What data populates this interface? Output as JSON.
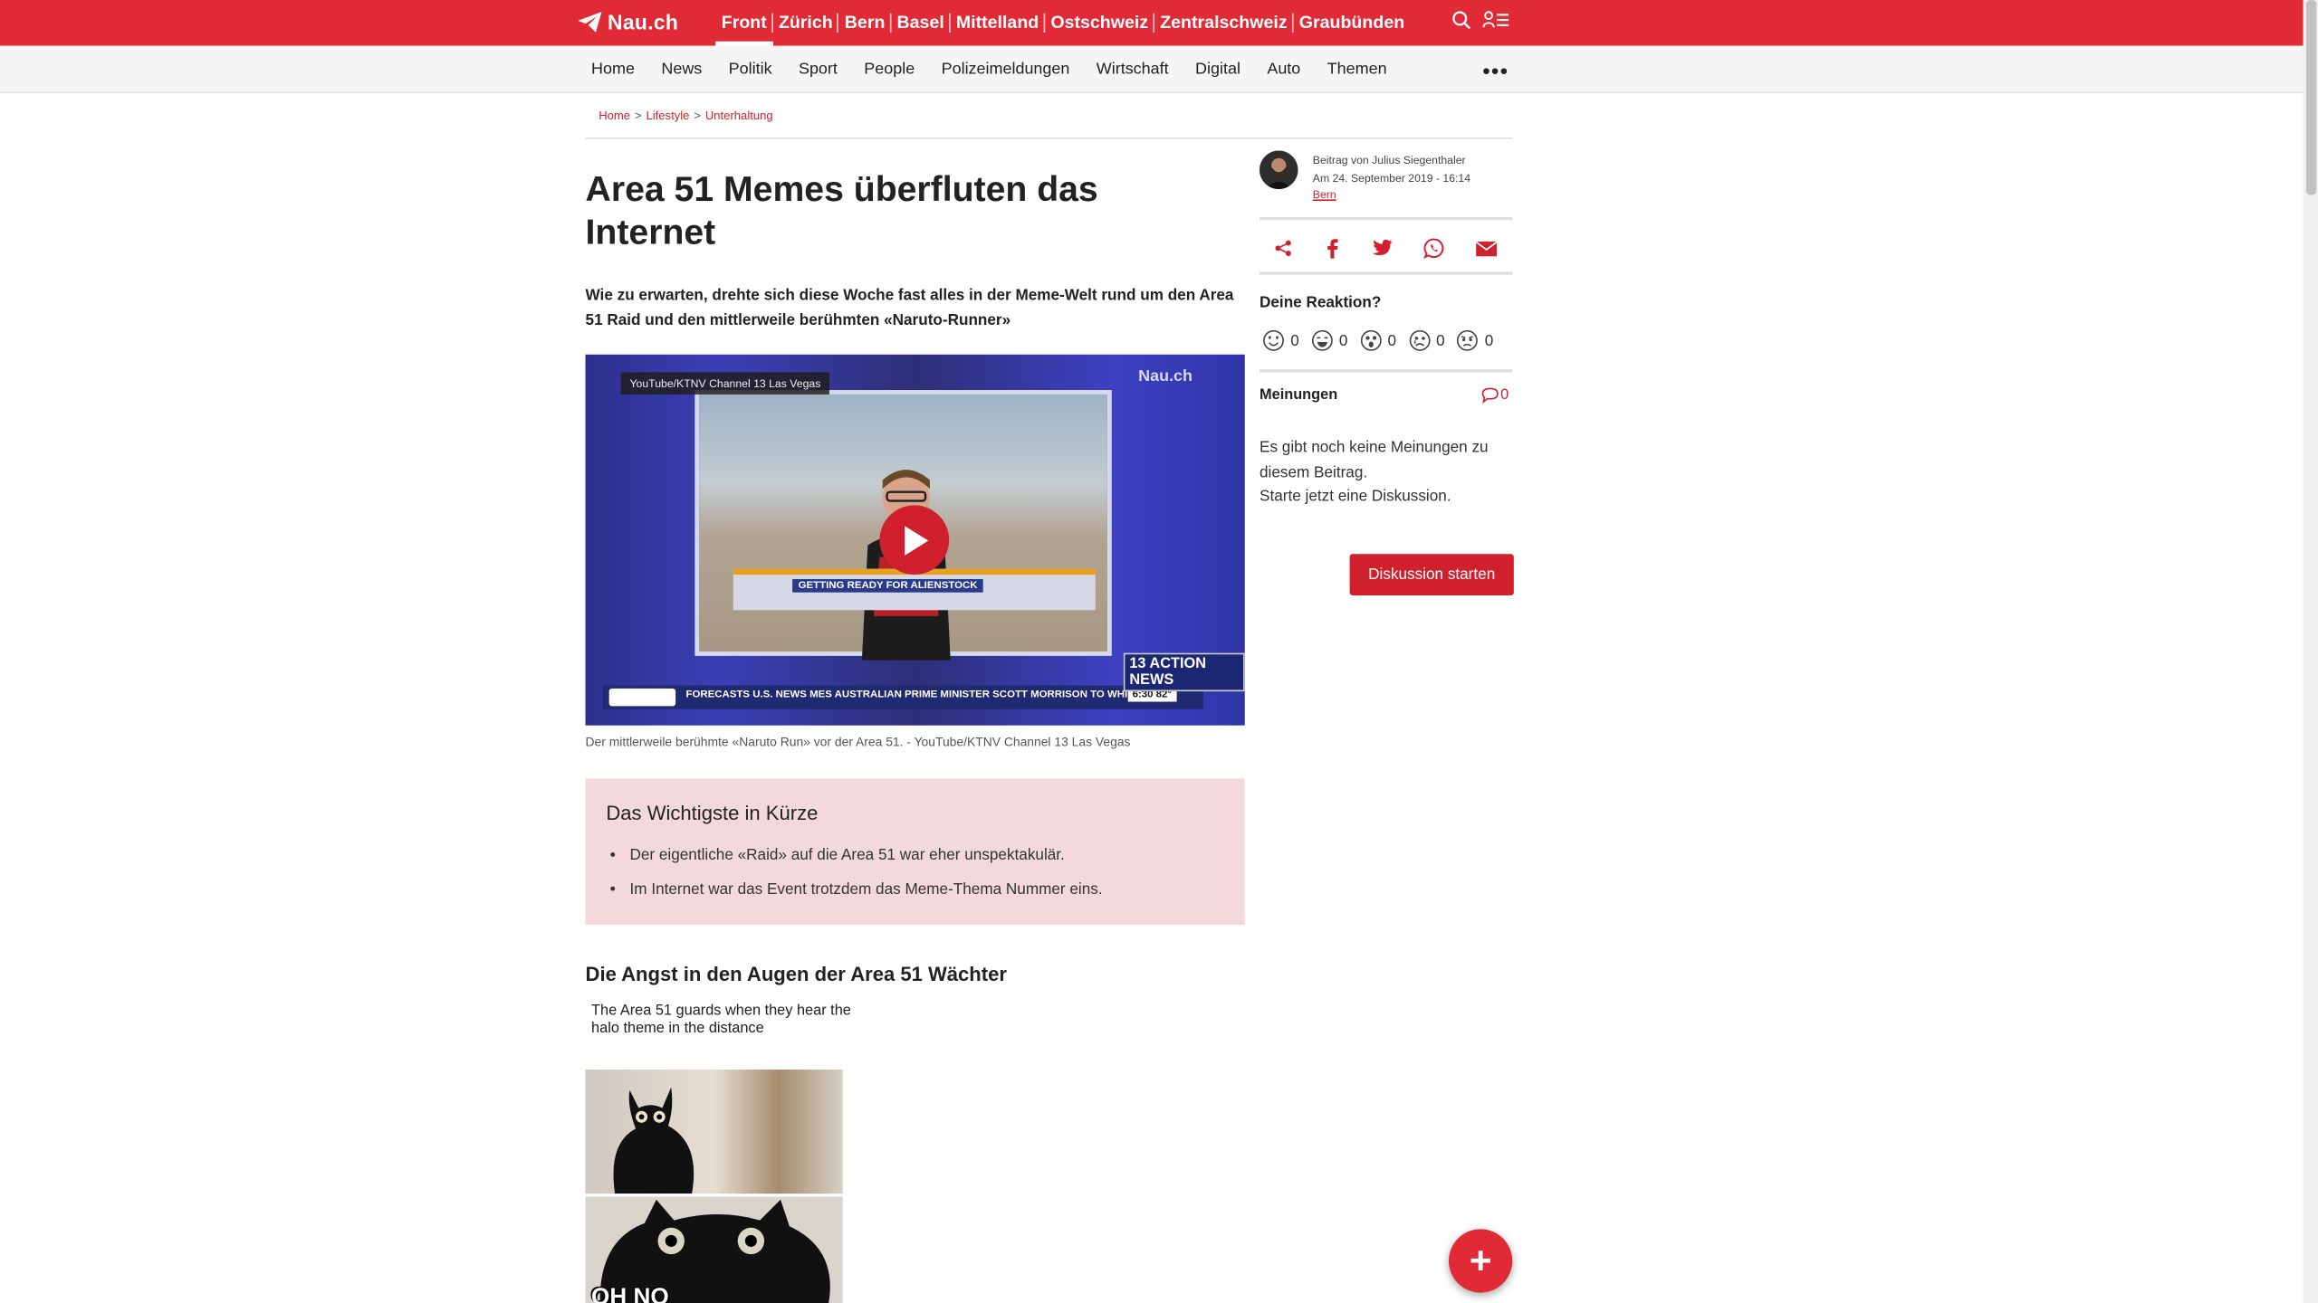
{
  "header": {
    "logo_text": "Nau.ch",
    "regions": [
      "Front",
      "Zürich",
      "Bern",
      "Basel",
      "Mittelland",
      "Ostschweiz",
      "Zentralschweiz",
      "Graubünden"
    ],
    "active_region": "Front",
    "brand_color": "#e02a36"
  },
  "nav": {
    "items": [
      "Home",
      "News",
      "Politik",
      "Sport",
      "People",
      "Polizeimeldungen",
      "Wirtschaft",
      "Digital",
      "Auto",
      "Themen"
    ],
    "more": "•••"
  },
  "breadcrumb": {
    "items": [
      "Home",
      "Lifestyle",
      "Unterhaltung"
    ],
    "separator": ">"
  },
  "article": {
    "title": "Area 51 Memes überfluten das Internet",
    "lead": "Wie zu erwarten, drehte sich diese Woche fast alles in der Meme-Welt rund um den Area 51 Raid und den mittlerweile berühmten «Naruto-Runner»",
    "video": {
      "channel_tag": "YouTube/KTNV Channel 13 Las Vegas",
      "watermark": "Nau.ch",
      "lower_third": "GETTING READY FOR ALIENSTOCK",
      "ticker": "FORECASTS  U.S. NEWS  MES AUSTRALIAN PRIME MINISTER SCOTT MORRISON TO WHIT",
      "time": "6:30  82°",
      "station": "13 ACTION NEWS"
    },
    "caption": "Der mittlerweile berühmte «Naruto Run» vor der Area 51. - YouTube/KTNV Channel 13 Las Vegas",
    "summary": {
      "heading": "Das Wichtigste in Kürze",
      "bullets": [
        "Der eigentliche «Raid» auf die Area 51 war eher unspektakulär.",
        "Im Internet war das Event trotzdem das Meme-Thema Nummer eins."
      ]
    },
    "subheading": "Die Angst in den Augen der Area 51 Wächter",
    "meme_caption": "The Area 51 guards when they hear the halo theme in the distance",
    "meme_overlay": "OH NO"
  },
  "sidebar": {
    "author_line": "Beitrag von Julius Siegenthaler",
    "date_line": "Am 24. September 2019 - 16:14",
    "location": "Bern",
    "reaction_title": "Deine Reaktion?",
    "reactions": [
      {
        "icon": "love-face-icon",
        "count": "0"
      },
      {
        "icon": "laugh-face-icon",
        "count": "0"
      },
      {
        "icon": "surprised-face-icon",
        "count": "0"
      },
      {
        "icon": "sad-face-icon",
        "count": "0"
      },
      {
        "icon": "angry-face-icon",
        "count": "0"
      }
    ],
    "comments_title": "Meinungen",
    "comments_count": "0",
    "no_comments_text": "Es gibt noch keine Meinungen zu diesem Beitrag.",
    "start_prompt": "Starte jetzt eine Diskussion.",
    "start_button": "Diskussion starten"
  },
  "fab_label": "+"
}
